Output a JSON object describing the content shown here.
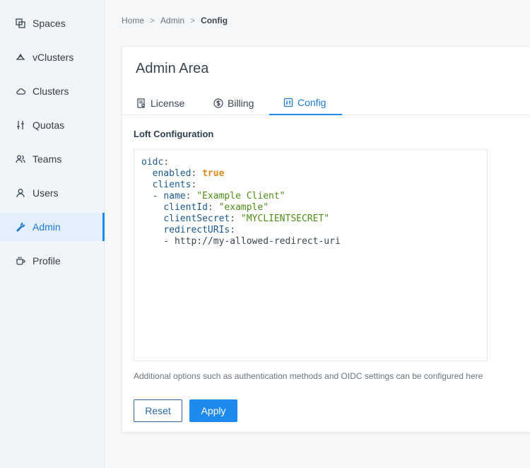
{
  "sidebar": {
    "items": [
      {
        "label": "Spaces",
        "icon": "spaces-icon"
      },
      {
        "label": "vClusters",
        "icon": "vcluster-icon"
      },
      {
        "label": "Clusters",
        "icon": "cloud-icon"
      },
      {
        "label": "Quotas",
        "icon": "sliders-icon"
      },
      {
        "label": "Teams",
        "icon": "teams-icon"
      },
      {
        "label": "Users",
        "icon": "user-icon"
      },
      {
        "label": "Admin",
        "icon": "wrench-icon"
      },
      {
        "label": "Profile",
        "icon": "coffee-icon"
      }
    ],
    "active": "Admin"
  },
  "breadcrumb": {
    "home": "Home",
    "admin": "Admin",
    "current": "Config",
    "separator": ">"
  },
  "card": {
    "title": "Admin Area",
    "tabs": [
      {
        "label": "License",
        "icon": "license-icon"
      },
      {
        "label": "Billing",
        "icon": "dollar-icon"
      },
      {
        "label": "Config",
        "icon": "config-icon"
      }
    ],
    "active_tab": "Config",
    "section_title": "Loft Configuration",
    "config_yaml": [
      "oidc:",
      "  enabled: true",
      "  clients:",
      "  - name: \"Example Client\"",
      "    clientId: \"example\"",
      "    clientSecret: \"MYCLIENTSECRET\"",
      "    redirectURIs:",
      "    - http://my-allowed-redirect-uri"
    ],
    "help_text": "Additional options such as authentication methods and OIDC settings can be configured here",
    "reset_label": "Reset",
    "apply_label": "Apply"
  },
  "colors": {
    "accent": "#1e8af0",
    "active_bg": "#e3f0fb",
    "yaml_string": "#4e8d18",
    "yaml_bool": "#d98a1a"
  }
}
